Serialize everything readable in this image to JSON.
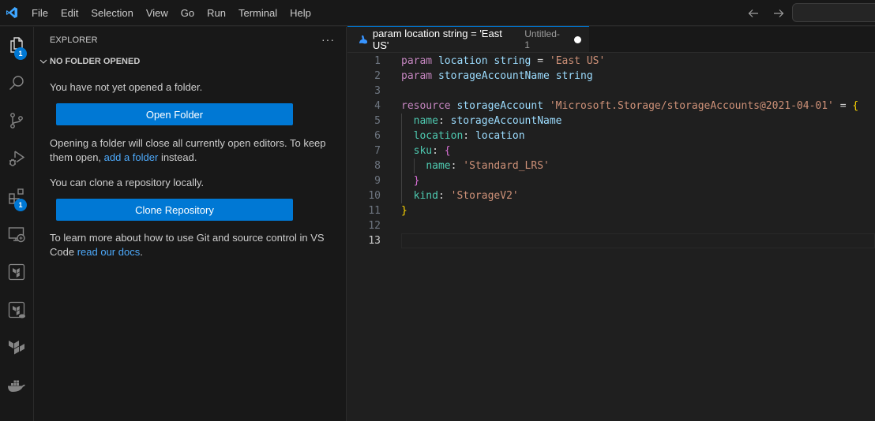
{
  "menu": [
    "File",
    "Edit",
    "Selection",
    "View",
    "Go",
    "Run",
    "Terminal",
    "Help"
  ],
  "titlebar": {
    "back_icon": "arrow-left-icon",
    "forward_icon": "arrow-right-icon",
    "command_center_placeholder": ""
  },
  "activity_bar": [
    {
      "name": "explorer",
      "icon": "files-icon",
      "badge": "1",
      "active": true
    },
    {
      "name": "search",
      "icon": "search-icon"
    },
    {
      "name": "source-control",
      "icon": "source-control-icon"
    },
    {
      "name": "run-and-debug",
      "icon": "run-debug-icon"
    },
    {
      "name": "extensions",
      "icon": "extensions-icon",
      "badge": "1"
    },
    {
      "name": "remote-explorer",
      "icon": "remote-explorer-icon"
    },
    {
      "name": "terraform",
      "icon": "terraform-box-icon"
    },
    {
      "name": "terraform-cloud",
      "icon": "terraform-cloud-icon"
    },
    {
      "name": "terraform-logo",
      "icon": "terraform-icon"
    },
    {
      "name": "docker",
      "icon": "docker-icon"
    }
  ],
  "sidebar": {
    "title": "EXPLORER",
    "more_label": "···",
    "section_title": "NO FOLDER OPENED",
    "no_folder_text": "You have not yet opened a folder.",
    "open_folder_button": "Open Folder",
    "warning_text_1": "Opening a folder will close all currently open editors. To keep them open, ",
    "warning_link": "add a folder",
    "warning_text_2": " instead.",
    "clone_text": "You can clone a repository locally.",
    "clone_button": "Clone Repository",
    "learn_text_1": "To learn more about how to use Git and source control in VS Code ",
    "learn_link": "read our docs",
    "learn_text_2": "."
  },
  "editor": {
    "tab": {
      "title": "param location string = 'East US'",
      "description": "Untitled-1",
      "dirty": true,
      "icon": "bicep-icon"
    },
    "current_line": 13,
    "lines": [
      {
        "n": "1",
        "tokens": [
          [
            "kw",
            "param"
          ],
          [
            "op",
            " "
          ],
          [
            "var",
            "location"
          ],
          [
            "op",
            " "
          ],
          [
            "var",
            "string"
          ],
          [
            "op",
            " = "
          ],
          [
            "str",
            "'East US'"
          ]
        ]
      },
      {
        "n": "2",
        "tokens": [
          [
            "kw",
            "param"
          ],
          [
            "op",
            " "
          ],
          [
            "var",
            "storageAccountName"
          ],
          [
            "op",
            " "
          ],
          [
            "var",
            "string"
          ]
        ]
      },
      {
        "n": "3",
        "tokens": []
      },
      {
        "n": "4",
        "tokens": [
          [
            "kw",
            "resource"
          ],
          [
            "op",
            " "
          ],
          [
            "var",
            "storageAccount"
          ],
          [
            "op",
            " "
          ],
          [
            "str",
            "'Microsoft.Storage/storageAccounts@2021-04-01'"
          ],
          [
            "op",
            " = "
          ],
          [
            "b1",
            "{"
          ]
        ]
      },
      {
        "n": "5",
        "tokens": [
          [
            "op",
            "  "
          ],
          [
            "prop",
            "name"
          ],
          [
            "op",
            ": "
          ],
          [
            "var",
            "storageAccountName"
          ]
        ]
      },
      {
        "n": "6",
        "tokens": [
          [
            "op",
            "  "
          ],
          [
            "prop",
            "location"
          ],
          [
            "op",
            ": "
          ],
          [
            "var",
            "location"
          ]
        ]
      },
      {
        "n": "7",
        "tokens": [
          [
            "op",
            "  "
          ],
          [
            "prop",
            "sku"
          ],
          [
            "op",
            ": "
          ],
          [
            "b2",
            "{"
          ]
        ]
      },
      {
        "n": "8",
        "tokens": [
          [
            "op",
            "    "
          ],
          [
            "prop",
            "name"
          ],
          [
            "op",
            ": "
          ],
          [
            "str",
            "'Standard_LRS'"
          ]
        ]
      },
      {
        "n": "9",
        "tokens": [
          [
            "op",
            "  "
          ],
          [
            "b2",
            "}"
          ]
        ]
      },
      {
        "n": "10",
        "tokens": [
          [
            "op",
            "  "
          ],
          [
            "prop",
            "kind"
          ],
          [
            "op",
            ": "
          ],
          [
            "str",
            "'StorageV2'"
          ]
        ]
      },
      {
        "n": "11",
        "tokens": [
          [
            "b1",
            "}"
          ]
        ]
      },
      {
        "n": "12",
        "tokens": []
      },
      {
        "n": "13",
        "tokens": []
      }
    ]
  }
}
